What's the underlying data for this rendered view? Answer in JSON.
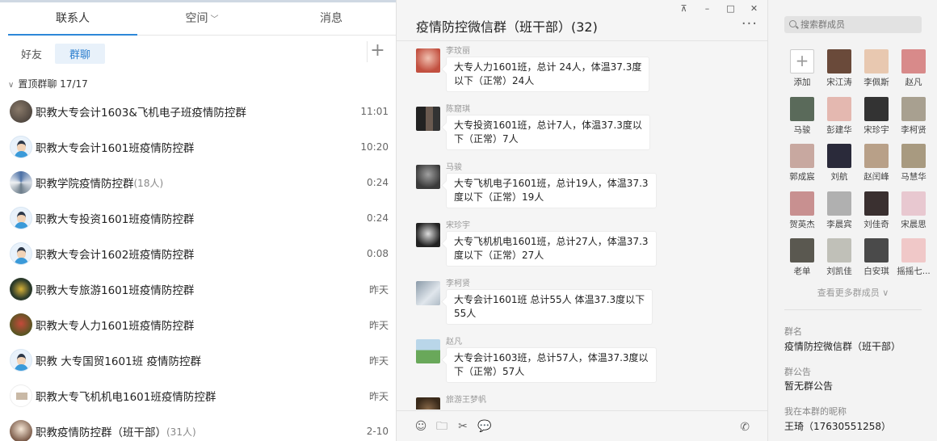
{
  "left": {
    "tabs": [
      {
        "label": "联系人",
        "active": true
      },
      {
        "label": "空间",
        "active": false,
        "has_dropdown": true
      },
      {
        "label": "消息",
        "active": false
      }
    ],
    "subtabs": [
      {
        "label": "好友",
        "active": false
      },
      {
        "label": "群聊",
        "active": true
      }
    ],
    "add_icon": "plus-icon",
    "section": {
      "label": "置顶群聊",
      "count": "17/17"
    },
    "groups": [
      {
        "name": "职教大专会计1603&飞机电子班疫情防控群",
        "count": "",
        "time": "11:01",
        "avatar": "photo1"
      },
      {
        "name": "职教大专会计1601班疫情防控群",
        "count": "",
        "time": "10:20",
        "avatar": "default"
      },
      {
        "name": "职教学院疫情防控群",
        "count": "(18人)",
        "time": "0:24",
        "avatar": "photo2"
      },
      {
        "name": "职教大专投资1601班疫情防控群",
        "count": "",
        "time": "0:24",
        "avatar": "default"
      },
      {
        "name": "职教大专会计1602班疫情防控群",
        "count": "",
        "time": "0:08",
        "avatar": "default"
      },
      {
        "name": "职教大专旅游1601班疫情防控群",
        "count": "",
        "time": "昨天",
        "avatar": "photo3"
      },
      {
        "name": "职教大专人力1601班疫情防控群",
        "count": "",
        "time": "昨天",
        "avatar": "photo4"
      },
      {
        "name": "职教 大专国贸1601班 疫情防控群",
        "count": "",
        "time": "昨天",
        "avatar": "default"
      },
      {
        "name": "职教大专飞机机电1601班疫情防控群",
        "count": "",
        "time": "昨天",
        "avatar": "photo5"
      },
      {
        "name": "职教疫情防控群（班干部）",
        "count": "(31人)",
        "time": "2-10",
        "avatar": "photo6"
      }
    ]
  },
  "chat": {
    "title": "疫情防控微信群（班干部）(32)",
    "window_controls": [
      "pin-icon",
      "minimize-icon",
      "maximize-icon",
      "close-icon"
    ],
    "messages": [
      {
        "sender": "李玟丽",
        "lines": [
          "大专人力1601班，总计 24人，体温37.3度",
          "以下（正常）24人"
        ]
      },
      {
        "sender": "陈窟琪",
        "lines": [
          "大专投资1601班，总计7人，体温37.3度以",
          "下（正常）7人"
        ]
      },
      {
        "sender": "马骏",
        "lines": [
          "大专飞机电子1601班，总计19人，体温37.3",
          "度以下（正常）19人"
        ]
      },
      {
        "sender": "宋珍宇",
        "lines": [
          "大专飞机机电1601班，总计27人，体温37.3",
          "度以下（正常）27人"
        ]
      },
      {
        "sender": "李柯贤",
        "lines": [
          "大专会计1601班 总计55人 体温37.3度以下",
          "55人"
        ]
      },
      {
        "sender": "赵凡",
        "lines": [
          "大专会计1603班，总计57人，体温37.3度以",
          "下（正常）57人"
        ]
      },
      {
        "sender": "旅游王梦帆",
        "lines": []
      }
    ],
    "toolbar_icons": [
      "emoji-icon",
      "folder-icon",
      "scissors-icon",
      "chat-bubble-icon"
    ],
    "call_icon": "phone-icon"
  },
  "members_panel": {
    "search_placeholder": "搜索群成员",
    "add_label": "添加",
    "members": [
      "宋江涛",
      "李佩斯",
      "赵凡",
      "马骏",
      "彭建华",
      "宋珍宇",
      "李柯贤",
      "郭成宸",
      "刘航",
      "赵闰峰",
      "马慧华",
      "贺英杰",
      "李晨宾",
      "刘佳奇",
      "宋晨思",
      "老单",
      "刘凯佳",
      "白安琪",
      "摇摇七..."
    ],
    "more_label": "查看更多群成员",
    "group_name_label": "群名",
    "group_name": "疫情防控微信群（班干部）",
    "notice_label": "群公告",
    "notice": "暂无群公告",
    "nickname_label": "我在本群的昵称",
    "nickname": "王琦（17630551258）"
  }
}
